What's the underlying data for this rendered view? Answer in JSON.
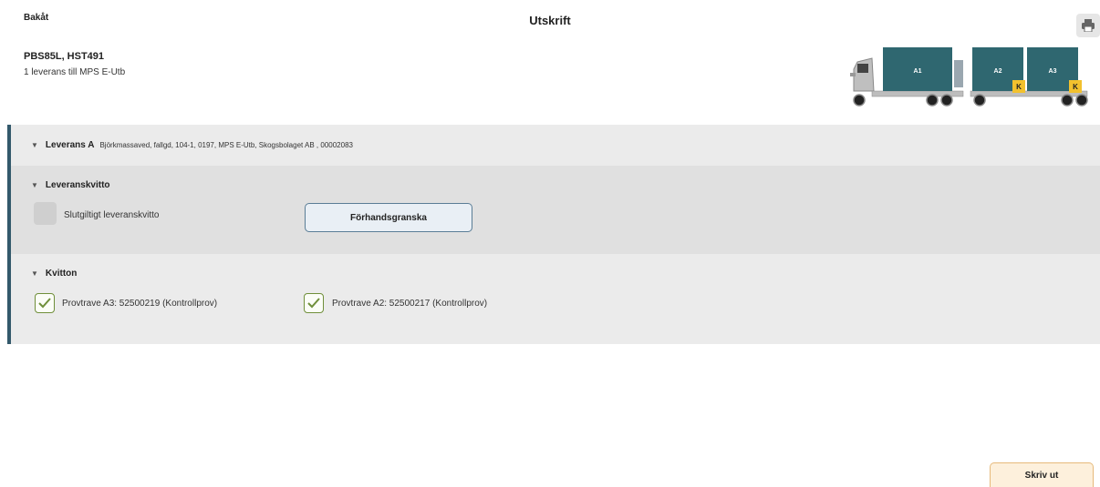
{
  "header": {
    "back_label": "Bakåt",
    "title": "Utskrift",
    "print_icon": "printer-icon"
  },
  "vehicle": {
    "id": "PBS85L, HST491",
    "deliveries": "1 leverans till MPS E-Utb",
    "loads": [
      {
        "label": "A1",
        "badge": ""
      },
      {
        "label": "A2",
        "badge": "K"
      },
      {
        "label": "A3",
        "badge": "K"
      }
    ],
    "colors": {
      "load": "#2f6770",
      "badge": "#f2c12e"
    }
  },
  "delivery": {
    "title": "Leverans A",
    "details": "Björkmassaved, fallgd, 104-1, 0197, MPS E-Utb, Skogsbolaget AB , 00002083"
  },
  "receipt_section": {
    "title": "Leveranskvitto",
    "final_receipt_label": "Slutgiltigt leveranskvitto",
    "final_receipt_checked": false,
    "preview_button": "Förhandsgranska"
  },
  "kvitton_section": {
    "title": "Kvitton",
    "items": [
      {
        "label": "Provtrave A3: 52500219 (Kontrollprov)",
        "checked": true
      },
      {
        "label": "Provtrave A2: 52500217 (Kontrollprov)",
        "checked": true
      }
    ]
  },
  "footer": {
    "print_button": "Skriv ut"
  },
  "accent_colors": {
    "section_bar": "#33596b",
    "check": "#6f8f3a",
    "print_button_bg": "#fdf0dc"
  }
}
